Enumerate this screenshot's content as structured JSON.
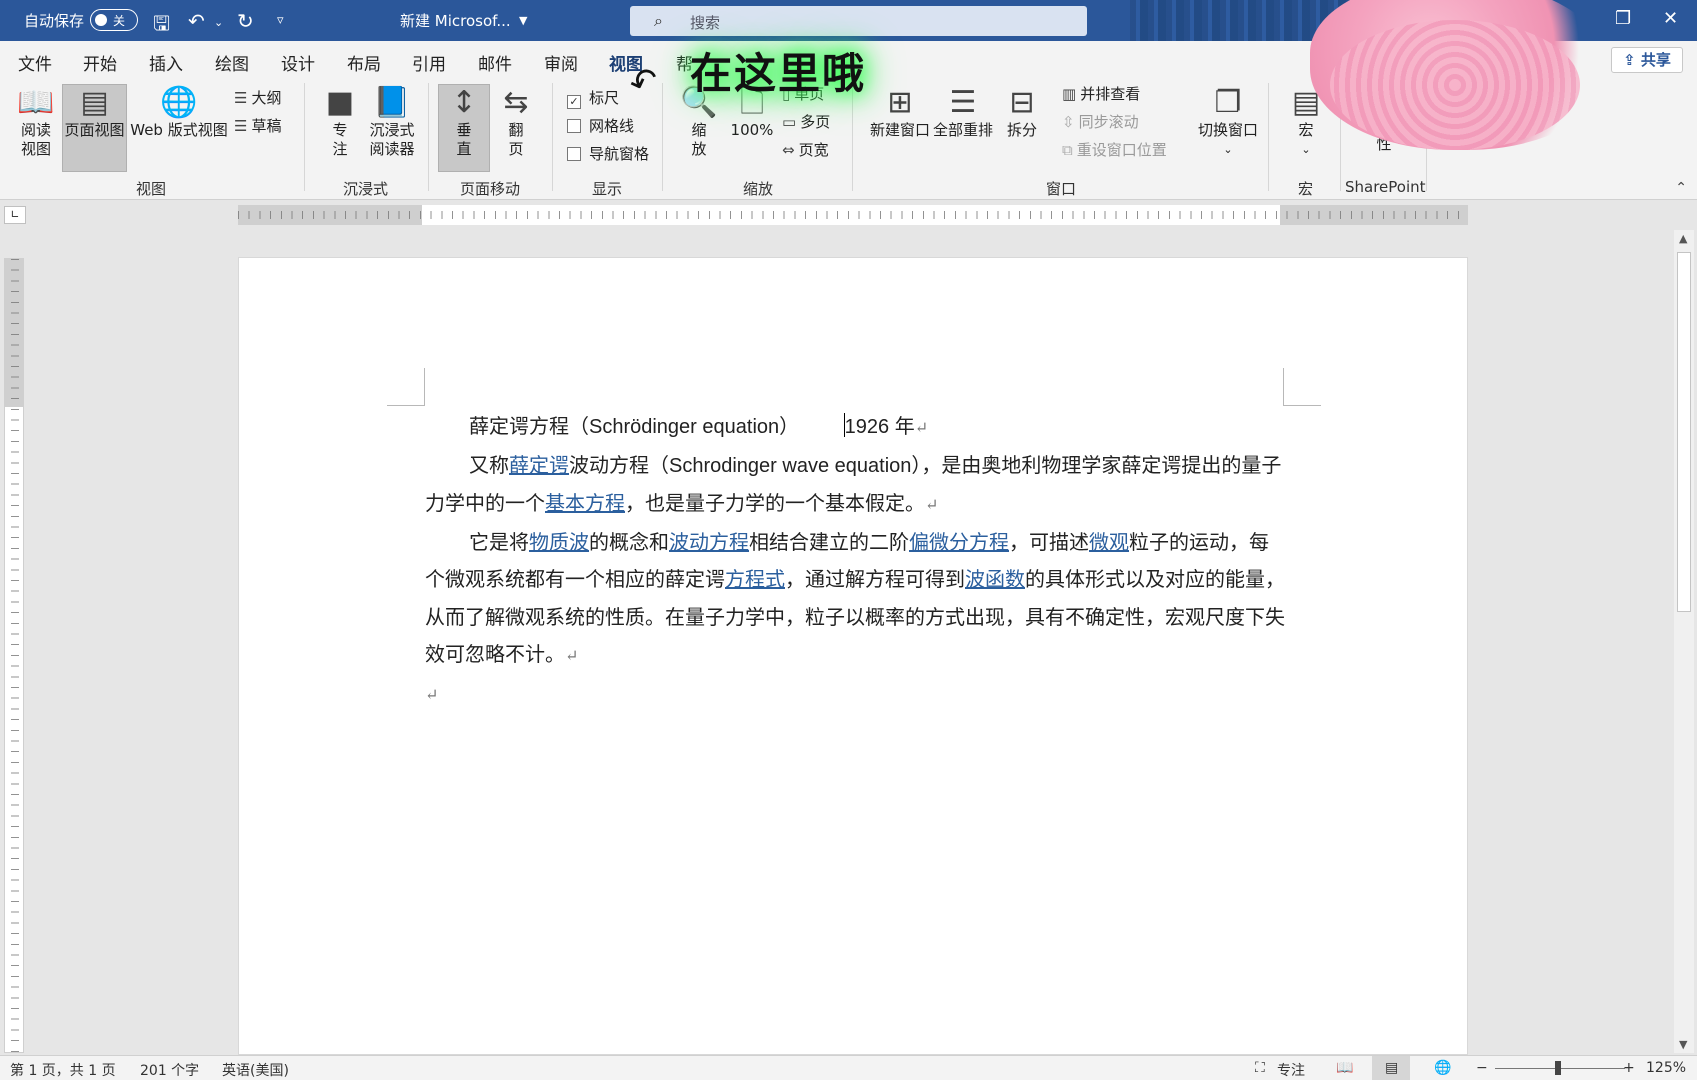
{
  "titlebar": {
    "autosave_label": "自动保存",
    "autosave_state": "关",
    "doc_title": "新建 Microsof...",
    "search_placeholder": "搜索"
  },
  "tabs": [
    "文件",
    "开始",
    "插入",
    "绘图",
    "设计",
    "布局",
    "引用",
    "邮件",
    "审阅",
    "视图",
    "帮"
  ],
  "active_tab": "视图",
  "share_label": "共享",
  "ribbon": {
    "views": {
      "read_line1": "阅读",
      "read_line2": "视图",
      "print_layout": "页面视图",
      "web_layout": "Web 版式视图",
      "outline": "大纲",
      "draft": "草稿",
      "group": "视图"
    },
    "immersive": {
      "focus_line1": "专",
      "focus_line2": "注",
      "reader_line1": "沉浸式",
      "reader_line2": "阅读器",
      "group": "沉浸式"
    },
    "page_movement": {
      "vertical_line1": "垂",
      "vertical_line2": "直",
      "side_line1": "翻",
      "side_line2": "页",
      "group": "页面移动"
    },
    "show": {
      "ruler": "标尺",
      "ruler_checked": true,
      "gridlines": "网格线",
      "gridlines_checked": false,
      "nav_pane": "导航窗格",
      "nav_pane_checked": false,
      "group": "显示"
    },
    "zoom": {
      "zoom_line1": "缩",
      "zoom_line2": "放",
      "hundred": "100%",
      "one_page": "单页",
      "multi_page": "多页",
      "page_width": "页宽",
      "group": "缩放"
    },
    "window": {
      "new_window": "新建窗口",
      "arrange_all": "全部重排",
      "split": "拆分",
      "side_by_side": "并排查看",
      "sync_scroll": "同步滚动",
      "reset_position": "重设窗口位置",
      "switch_windows": "切换窗口",
      "group": "窗口"
    },
    "macros": {
      "label": "宏",
      "group": "宏"
    },
    "sharepoint": {
      "label": "性",
      "group": "SharePoint"
    }
  },
  "overlay": {
    "annotation": "在这里哦"
  },
  "document": {
    "title_cn": "薛定谔方程",
    "title_en": "（Schrödinger equation）",
    "title_year": "1926 年",
    "p1_a": "又称",
    "p1_link1": "薛定谔",
    "p1_b": "波动方程",
    "p1_en": "（Schrodinger wave equation）",
    "p1_c": "，是由奥地利物理学家薛定谔提出的量子力学中的一个",
    "p1_link2": "基本方程",
    "p1_d": "，也是量子力学的一个基本假定。",
    "p2_a": "它是将",
    "p2_link1": "物质波",
    "p2_b": "的概念和",
    "p2_link2": "波动方程",
    "p2_c": "相结合建立的二阶",
    "p2_link3": "偏微分方程",
    "p2_d": "，可描述",
    "p2_link4": "微观",
    "p2_e": "粒子的运动，每个微观系统都有一个相应的薛定谔",
    "p2_link5": "方程式",
    "p2_f": "，通过解方程可得到",
    "p2_link6": "波函数",
    "p2_g": "的具体形式以及对应的能量，从而了解微观系统的性质。在量子力学中，粒子以概率的方式出现，具有不确定性，宏观尺度下失效可忽略不计。",
    "para_mark": "↵"
  },
  "statusbar": {
    "page": "第 1 页，共 1 页",
    "words": "201 个字",
    "language": "英语(美国)",
    "focus": "专注",
    "zoom_minus": "−",
    "zoom_plus": "+",
    "zoom": "125%"
  }
}
